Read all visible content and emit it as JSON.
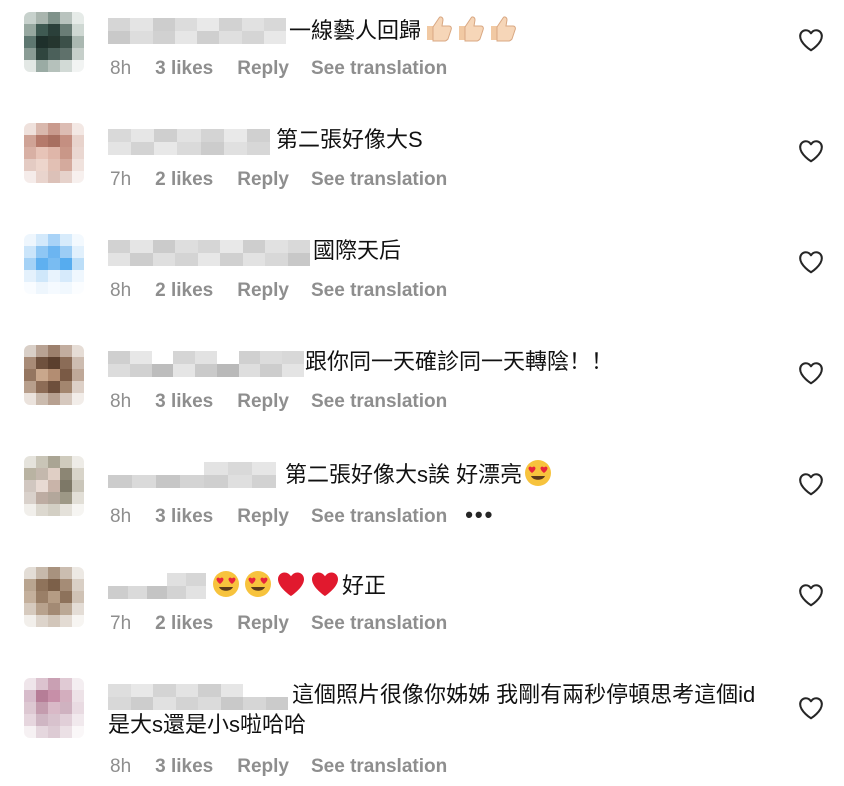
{
  "comments": [
    {
      "text": "一線藝人回歸",
      "text_suffix_emoji": [
        "thumbs-up-light",
        "thumbs-up-light",
        "thumbs-up-light"
      ],
      "time": "8h",
      "likes": "3 likes",
      "reply": "Reply",
      "translation": "See translation"
    },
    {
      "text": "第二張好像大S",
      "time": "7h",
      "likes": "2 likes",
      "reply": "Reply",
      "translation": "See translation"
    },
    {
      "text": "國際天后",
      "time": "8h",
      "likes": "2 likes",
      "reply": "Reply",
      "translation": "See translation"
    },
    {
      "text": "跟你同一天確診同一天轉陰！！",
      "time": "8h",
      "likes": "3 likes",
      "reply": "Reply",
      "translation": "See translation"
    },
    {
      "text": "第二張好像大s誒 好漂亮",
      "text_suffix_emoji": [
        "heart-eyes-face"
      ],
      "time": "8h",
      "likes": "3 likes",
      "reply": "Reply",
      "translation": "See translation",
      "more": "•••"
    },
    {
      "text_prefix_emoji": [
        "heart-eyes-face",
        "heart-eyes-face",
        "red-heart",
        "red-heart"
      ],
      "text": "好正",
      "time": "7h",
      "likes": "2 likes",
      "reply": "Reply",
      "translation": "See translation"
    },
    {
      "text": "這個照片很像你姊姊 我剛有兩秒停頓思考這個id是大s還是小s啦哈哈",
      "time": "8h",
      "likes": "3 likes",
      "reply": "Reply",
      "translation": "See translation"
    }
  ],
  "icons": {
    "like": "heart-outline-icon",
    "more": "more-horizontal-icon"
  },
  "colors": {
    "meta_text": "#8e8e8e",
    "comment_text": "#111111",
    "heart_stroke": "#262626"
  }
}
